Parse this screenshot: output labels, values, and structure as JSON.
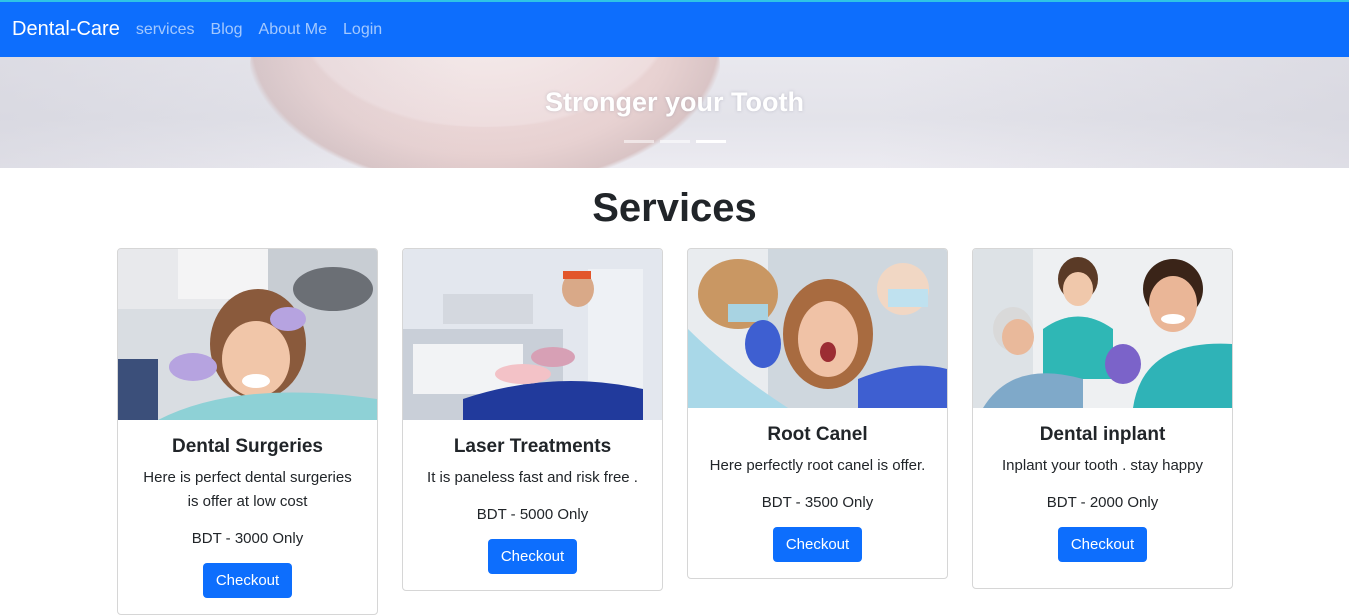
{
  "navbar": {
    "brand": "Dental-Care",
    "links": [
      "services",
      "Blog",
      "About Me",
      "Login"
    ]
  },
  "hero": {
    "caption": "Stronger your Tooth",
    "active_slide": 3,
    "slide_count": 3
  },
  "services": {
    "title": "Services",
    "cards": [
      {
        "title": "Dental Surgeries",
        "text": "Here is perfect dental surgeries is offer at low cost",
        "price": "BDT - 3000 Only",
        "button": "Checkout"
      },
      {
        "title": "Laser Treatments",
        "text": "It is paneless fast and risk free .",
        "price": "BDT - 5000 Only",
        "button": "Checkout"
      },
      {
        "title": "Root Canel",
        "text": "Here perfectly root canel is offer.",
        "price": "BDT - 3500 Only",
        "button": "Checkout"
      },
      {
        "title": "Dental inplant",
        "text": "Inplant your tooth . stay happy",
        "price": "BDT - 2000 Only",
        "button": "Checkout"
      }
    ]
  },
  "colors": {
    "primary": "#0d6efd",
    "nav_link": "rgba(255,255,255,0.62)"
  }
}
